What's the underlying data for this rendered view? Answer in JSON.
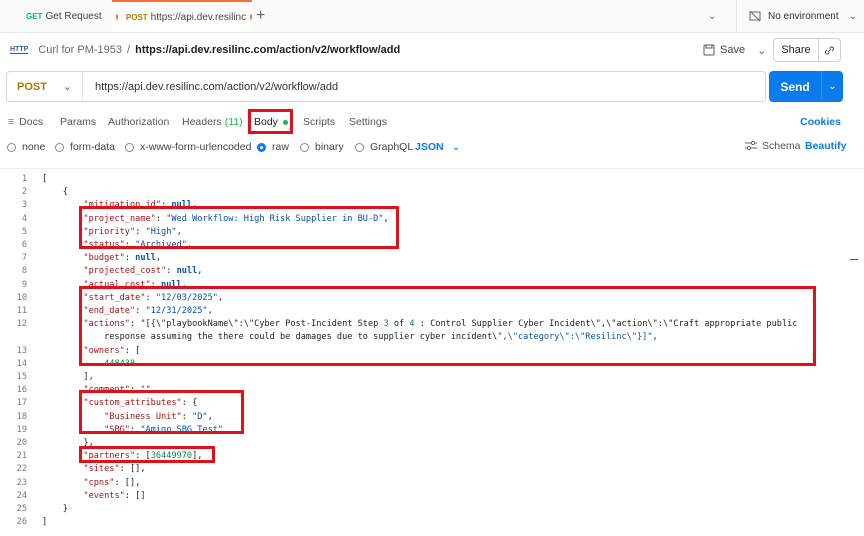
{
  "tabs": [
    {
      "method": "GET",
      "label": "Get Request",
      "active": false
    },
    {
      "method": "POST",
      "label": "https://api.dev.resilinc",
      "active": true
    }
  ],
  "new_tab_label": "+",
  "environment": {
    "label": "No environment"
  },
  "breadcrumb": {
    "collection": "Curl for PM-1953",
    "separator": "/",
    "request": "https://api.dev.resilinc.com/action/v2/workflow/add"
  },
  "toolbar": {
    "save_label": "Save",
    "share_label": "Share"
  },
  "request": {
    "method": "POST",
    "url": "https://api.dev.resilinc.com/action/v2/workflow/add",
    "send_label": "Send"
  },
  "request_tabs": {
    "docs": "Docs",
    "params": "Params",
    "authorization": "Authorization",
    "headers": "Headers",
    "headers_count": "(11)",
    "body": "Body",
    "scripts": "Scripts",
    "settings": "Settings",
    "cookies": "Cookies"
  },
  "body_types": {
    "none": "none",
    "form_data": "form-data",
    "urlencoded": "x-www-form-urlencoded",
    "raw": "raw",
    "binary": "binary",
    "graphql": "GraphQL",
    "format": "JSON",
    "schema": "Schema",
    "beautify": "Beautify",
    "selected": "raw"
  },
  "code_lines": [
    "[",
    "    {",
    "        \"mitigation_id\": null,",
    "        \"project_name\": \"Wed Workflow: High Risk Supplier in BU-D\",",
    "        \"priority\": \"High\",",
    "        \"status\": \"Archived\",",
    "        \"budget\": null,",
    "        \"projected_cost\": null,",
    "        \"actual_cost\": null,",
    "        \"start_date\": \"12/03/2025\",",
    "        \"end_date\": \"12/31/2025\",",
    "        \"actions\": \"[{\\\"playbookName\\\":\\\"Cyber Post-Incident Step 3 of 4 : Control Supplier Cyber Incident\\\",\\\"action\\\":\\\"Craft appropriate public",
    "            response assuming the there could be damages due to supplier cyber incident\\\",\\\"category\\\":\\\"Resilinc\\\"}]\",",
    "        \"owners\": [",
    "            448438",
    "        ],",
    "        \"comment\": \"\",",
    "        \"custom_attributes\": {",
    "            \"Business Unit\": \"D\",",
    "            \"SBG\": \"Amigo SBG Test\"",
    "        },",
    "        \"partners\": [36449970],",
    "        \"sites\": [],",
    "        \"cpns\": [],",
    "        \"events\": []",
    "    }",
    "]"
  ],
  "line_numbers": [
    "1",
    "2",
    "3",
    "4",
    "5",
    "6",
    "7",
    "8",
    "9",
    "10",
    "11",
    "12",
    "",
    "13",
    "14",
    "15",
    "16",
    "17",
    "18",
    "19",
    "20",
    "21",
    "22",
    "23",
    "24",
    "25",
    "26"
  ],
  "colors": {
    "accent": "#097bed",
    "post": "#ad7a03",
    "get": "#0cbb52",
    "highlight": "#e0111a",
    "tab_indicator": "#ff6c37"
  }
}
